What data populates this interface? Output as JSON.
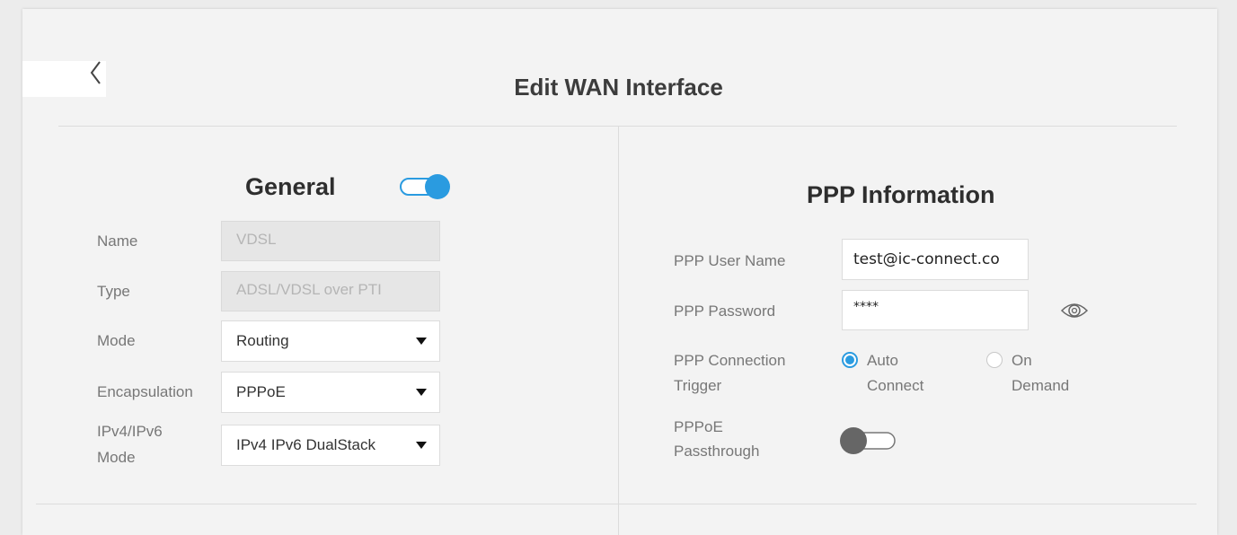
{
  "page": {
    "title": "Edit WAN Interface"
  },
  "general": {
    "title": "General",
    "enabled": true,
    "name": {
      "label": "Name",
      "value": "VDSL"
    },
    "type": {
      "label": "Type",
      "value": "ADSL/VDSL over PTI"
    },
    "mode": {
      "label": "Mode",
      "value": "Routing"
    },
    "encapsulation": {
      "label": "Encapsulation",
      "value": "PPPoE"
    },
    "ip_mode": {
      "label_line1": "IPv4/IPv6",
      "label_line2": "Mode",
      "value": "IPv4 IPv6 DualStack"
    }
  },
  "ppp": {
    "title": "PPP Information",
    "user_name": {
      "label": "PPP User Name",
      "value": "test@ic-connect.co"
    },
    "password": {
      "label": "PPP Password",
      "value": "****"
    },
    "trigger": {
      "label_line1": "PPP Connection",
      "label_line2": "Trigger",
      "options": [
        {
          "line1": "Auto",
          "line2": "Connect",
          "selected": true
        },
        {
          "line1": "On",
          "line2": "Demand",
          "selected": false
        }
      ]
    },
    "passthrough": {
      "label_line1": "PPPoE",
      "label_line2": "Passthrough",
      "enabled": false
    }
  },
  "colors": {
    "accent": "#2a9be0",
    "toggle_off": "#666666"
  },
  "icons": {
    "back": "chevron-left-icon",
    "show_password": "eye-icon"
  }
}
